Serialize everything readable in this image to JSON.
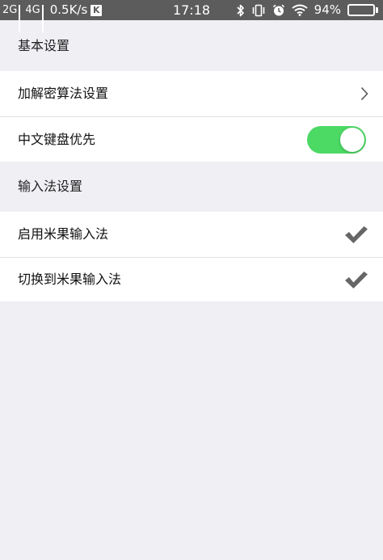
{
  "status_bar": {
    "sim1_label": "2G",
    "sim2_label": "4G",
    "net_speed": "0.5K/s",
    "k_badge": "K",
    "time": "17:18",
    "battery_percent": "94%",
    "battery_level": 0.94
  },
  "sections": {
    "basic": {
      "title": "基本设置"
    },
    "ime": {
      "title": "输入法设置"
    }
  },
  "rows": {
    "encrypt": {
      "label": "加解密算法设置"
    },
    "chinese_keyboard": {
      "label": "中文键盘优先",
      "enabled": true
    },
    "enable_ime": {
      "label": "启用米果输入法",
      "checked": true
    },
    "switch_ime": {
      "label": "切换到米果输入法",
      "checked": true
    }
  },
  "colors": {
    "toggle_on": "#4cd964",
    "check": "#666666",
    "background": "#efeff4",
    "status_bar": "#5c5c5c"
  },
  "icons": [
    "bluetooth-icon",
    "vibrate-icon",
    "alarm-icon",
    "wifi-icon",
    "battery-icon",
    "chevron-right-icon",
    "checkmark-icon"
  ]
}
